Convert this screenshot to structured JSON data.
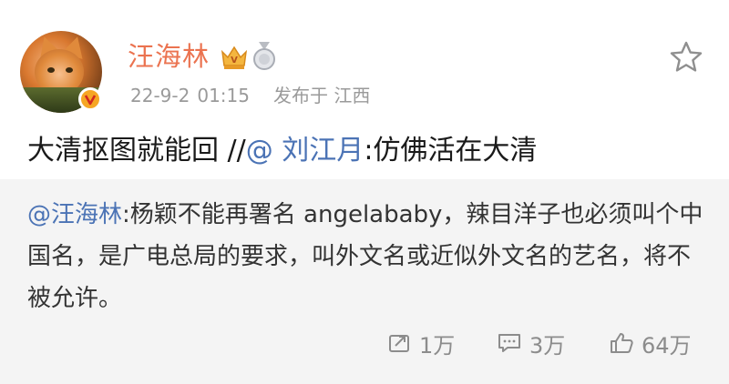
{
  "post": {
    "author": "汪海林",
    "date": "22-9-2",
    "time": "01:15",
    "location": "发布于 江西",
    "text_main": "大清抠图就能回 //",
    "mention_user": "@ 刘江月",
    "text_tail": ":仿佛活在大清"
  },
  "repost": {
    "mention": "@汪海林",
    "text": ":杨颖不能再署名 angelababy，辣目洋子也必须叫个中国名，是广电总局的要求，叫外文名或近似外文名的艺名，将不被允许。"
  },
  "actions": {
    "forward_count": "1万",
    "comment_count": "3万",
    "like_count": "64万"
  },
  "colors": {
    "name": "#eb7350",
    "link": "#4b73b5",
    "repost_bg": "#f4f4f4",
    "muted": "#9a9a9a"
  },
  "icons": [
    "verified-badge-icon",
    "crown-badge-icon",
    "medal-badge-icon",
    "star-favorite-icon",
    "forward-icon",
    "comment-icon",
    "like-icon"
  ]
}
